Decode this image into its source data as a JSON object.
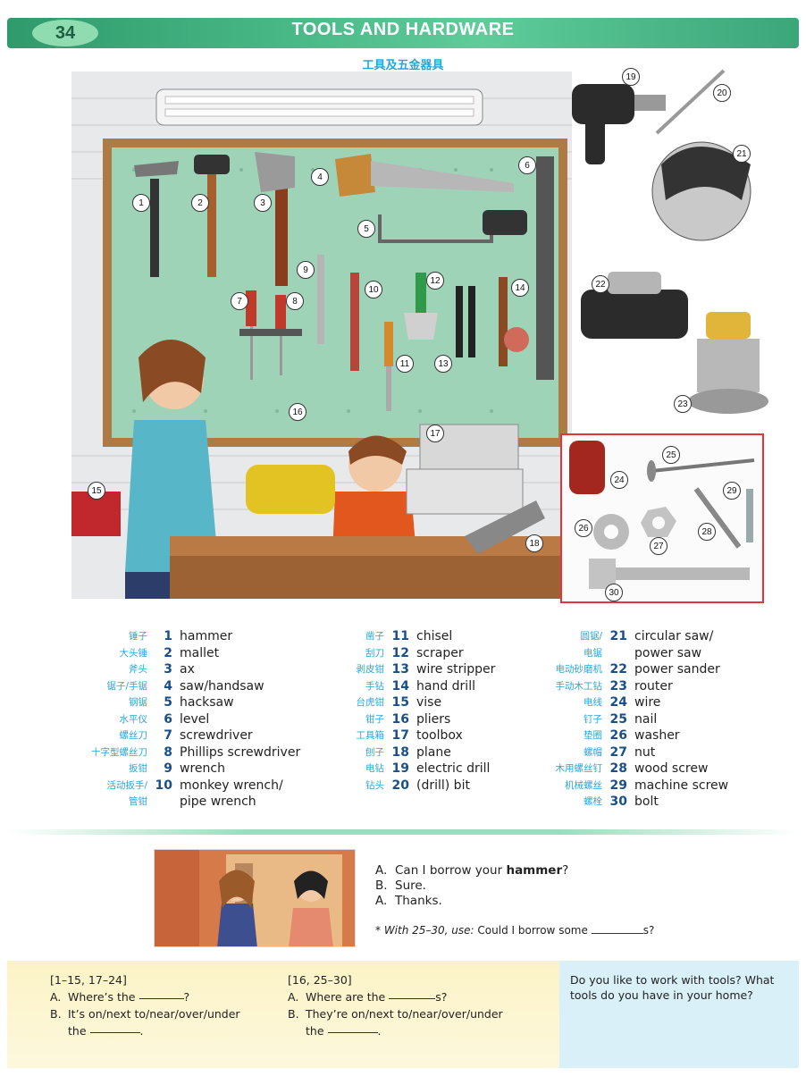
{
  "header": {
    "page_number": "34",
    "title": "TOOLS AND HARDWARE",
    "subtitle_zh": "工具及五金器具"
  },
  "colors": {
    "header_green": "#3ba67a",
    "number_blue": "#1a4f8a",
    "chinese_cyan": "#2aa6d6",
    "hardware_border": "#e3343c"
  },
  "illustration_numbers": [
    "1",
    "2",
    "3",
    "4",
    "5",
    "6",
    "7",
    "8",
    "9",
    "10",
    "11",
    "12",
    "13",
    "14",
    "15",
    "16",
    "17",
    "18"
  ],
  "right_tools_numbers": [
    "19",
    "20",
    "21",
    "22",
    "23"
  ],
  "hardware_numbers": [
    "24",
    "25",
    "26",
    "27",
    "28",
    "29",
    "30"
  ],
  "words": {
    "col1": [
      {
        "zh": "锤子",
        "num": "1",
        "en": "hammer"
      },
      {
        "zh": "大头锤",
        "num": "2",
        "en": "mallet"
      },
      {
        "zh": "斧头",
        "num": "3",
        "en": "ax"
      },
      {
        "zh": "锯子/手锯",
        "num": "4",
        "en": "saw/handsaw"
      },
      {
        "zh": "钢锯",
        "num": "5",
        "en": "hacksaw"
      },
      {
        "zh": "水平仪",
        "num": "6",
        "en": "level"
      },
      {
        "zh": "螺丝刀",
        "num": "7",
        "en": "screwdriver"
      },
      {
        "zh": "十字型螺丝刀",
        "num": "8",
        "en": "Phillips screwdriver"
      },
      {
        "zh": "扳钳",
        "num": "9",
        "en": "wrench"
      },
      {
        "zh": "活动扳手/",
        "num": "10",
        "en": "monkey wrench/"
      },
      {
        "zh": "管钳",
        "num": "",
        "en": "pipe wrench"
      }
    ],
    "col2": [
      {
        "zh": "凿子",
        "num": "11",
        "en": "chisel"
      },
      {
        "zh": "刮刀",
        "num": "12",
        "en": "scraper"
      },
      {
        "zh": "剥皮钳",
        "num": "13",
        "en": "wire stripper"
      },
      {
        "zh": "手钻",
        "num": "14",
        "en": "hand drill"
      },
      {
        "zh": "台虎钳",
        "num": "15",
        "en": "vise"
      },
      {
        "zh": "钳子",
        "num": "16",
        "en": "pliers"
      },
      {
        "zh": "工具箱",
        "num": "17",
        "en": "toolbox"
      },
      {
        "zh": "刨子",
        "num": "18",
        "en": "plane"
      },
      {
        "zh": "电钻",
        "num": "19",
        "en": "electric drill"
      },
      {
        "zh": "钻头",
        "num": "20",
        "en": "(drill) bit"
      }
    ],
    "col3": [
      {
        "zh": "圆锯/",
        "num": "21",
        "en": "circular saw/"
      },
      {
        "zh": "电锯",
        "num": "",
        "en": "power saw"
      },
      {
        "zh": "电动砂磨机",
        "num": "22",
        "en": "power sander"
      },
      {
        "zh": "手动木工钻",
        "num": "23",
        "en": "router"
      },
      {
        "zh": "电线",
        "num": "24",
        "en": "wire"
      },
      {
        "zh": "钉子",
        "num": "25",
        "en": "nail"
      },
      {
        "zh": "垫圈",
        "num": "26",
        "en": "washer"
      },
      {
        "zh": "螺帽",
        "num": "27",
        "en": "nut"
      },
      {
        "zh": "木用螺丝钉",
        "num": "28",
        "en": "wood screw"
      },
      {
        "zh": "机械螺丝",
        "num": "29",
        "en": "machine screw"
      },
      {
        "zh": "螺栓",
        "num": "30",
        "en": "bolt"
      }
    ]
  },
  "dialog": {
    "a1_letter": "A.",
    "a1_pre": "Can I borrow your ",
    "a1_bold": "hammer",
    "a1_post": "?",
    "b_letter": "B.",
    "b_text": "Sure.",
    "a2_letter": "A.",
    "a2_text": "Thanks.",
    "note_italic": "* With 25–30, use:",
    "note_text": "Could I borrow some",
    "note_end": "s?"
  },
  "practice_left": {
    "range": "[1–15, 17–24]",
    "a_letter": "A.",
    "a_text": "Where’s the",
    "a_end": "?",
    "b_letter": "B.",
    "b_text": "It’s on/next to/near/over/under",
    "b_text2": "the",
    "b_end": "."
  },
  "practice_right": {
    "range": "[16, 25–30]",
    "a_letter": "A.",
    "a_text": "Where are the",
    "a_end": "s?",
    "b_letter": "B.",
    "b_text": "They’re on/next to/near/over/under",
    "b_text2": "the",
    "b_end": "."
  },
  "side_question": "Do you like to work with tools? What tools do you have in your home?"
}
